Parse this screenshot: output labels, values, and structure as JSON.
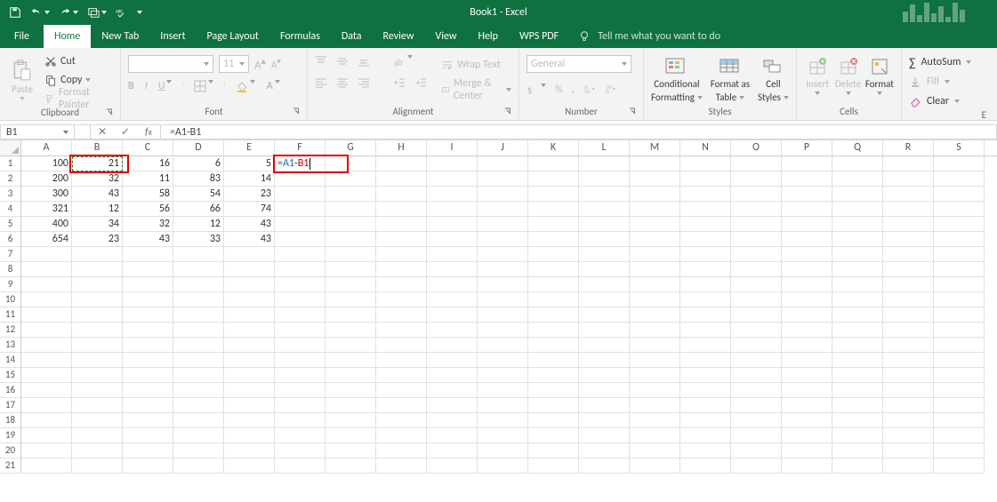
{
  "titlebar": {
    "title": "Book1  -  Excel"
  },
  "tabs": {
    "file": "File",
    "home": "Home",
    "newtab": "New Tab",
    "insert": "Insert",
    "pagelayout": "Page Layout",
    "formulas": "Formulas",
    "data": "Data",
    "review": "Review",
    "view": "View",
    "help": "Help",
    "wpspdf": "WPS PDF",
    "tellme": "Tell me what you want to do"
  },
  "ribbon": {
    "clipboard": {
      "paste": "Paste",
      "cut": "Cut",
      "copy": "Copy",
      "fmtpainter": "Format Painter",
      "label": "Clipboard"
    },
    "font": {
      "size": "11",
      "bold": "B",
      "italic": "I",
      "underline": "U",
      "label": "Font"
    },
    "alignment": {
      "wrap": "Wrap Text",
      "merge": "Merge & Center",
      "label": "Alignment"
    },
    "number": {
      "general": "General",
      "label": "Number"
    },
    "styles": {
      "cond": "Conditional",
      "cond2": "Formatting",
      "fmtas": "Format as",
      "fmtas2": "Table",
      "cellst": "Cell",
      "cellst2": "Styles",
      "label": "Styles"
    },
    "cells": {
      "insert": "Insert",
      "delete": "Delete",
      "format": "Format",
      "label": "Cells"
    },
    "editing": {
      "autosum": "AutoSum",
      "fill": "Fill",
      "clear": "Clear",
      "label": "E"
    }
  },
  "namebox": "B1",
  "formula": {
    "text": "=A1-B1",
    "a": "A1",
    "b": "B1"
  },
  "columns": [
    "A",
    "B",
    "C",
    "D",
    "E",
    "F",
    "G",
    "H",
    "I",
    "J",
    "K",
    "L",
    "M",
    "N",
    "O",
    "P",
    "Q",
    "R",
    "S"
  ],
  "rows": [
    "1",
    "2",
    "3",
    "4",
    "5",
    "6",
    "7",
    "8",
    "9",
    "10",
    "11",
    "12",
    "13",
    "14",
    "15",
    "16",
    "17",
    "18",
    "19",
    "20",
    "21"
  ],
  "cells": {
    "A": [
      100,
      200,
      300,
      321,
      400,
      654
    ],
    "B": [
      21,
      32,
      43,
      12,
      34,
      23
    ],
    "C": [
      16,
      11,
      58,
      56,
      32,
      43
    ],
    "D": [
      6,
      83,
      54,
      66,
      12,
      33
    ],
    "E": [
      5,
      14,
      23,
      74,
      43,
      43
    ]
  },
  "f1_formula": "=A1-B1"
}
